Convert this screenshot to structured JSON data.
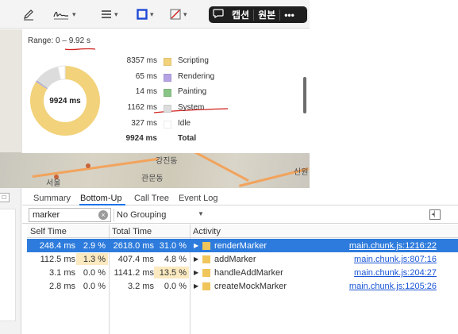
{
  "toolbar": {
    "pill": {
      "caption": "캡션",
      "original": "원본",
      "more": "•••"
    }
  },
  "map": {
    "labels": [
      "서울",
      "관문동",
      "신원",
      "강진동"
    ]
  },
  "summary": {
    "range_label": "Range: 0 – 9.92 s",
    "center_label": "9924 ms",
    "legend": [
      {
        "ms": "8357 ms",
        "name": "Scripting",
        "color": "#f2d27a"
      },
      {
        "ms": "65 ms",
        "name": "Rendering",
        "color": "#b5a3e4"
      },
      {
        "ms": "14 ms",
        "name": "Painting",
        "color": "#89c487"
      },
      {
        "ms": "1162 ms",
        "name": "System",
        "color": "#dcdcdc"
      },
      {
        "ms": "327 ms",
        "name": "Idle",
        "color": "#ffffff"
      }
    ],
    "total": {
      "ms": "9924 ms",
      "name": "Total"
    }
  },
  "devtools": {
    "tabs": [
      "Summary",
      "Bottom-Up",
      "Call Tree",
      "Event Log"
    ],
    "active_tab": "Bottom-Up",
    "filter": {
      "value": "marker",
      "placeholder": "Filter"
    },
    "grouping": "No Grouping",
    "columns": {
      "self": "Self Time",
      "total": "Total Time",
      "activity": "Activity"
    },
    "rows": [
      {
        "self_ms": "248.4 ms",
        "self_pct": "2.9 %",
        "total_ms": "2618.0 ms",
        "total_pct": "31.0 %",
        "activity": "renderMarker",
        "source": "main.chunk.js:1216:22",
        "selected": true
      },
      {
        "self_ms": "112.5 ms",
        "self_pct": "1.3 %",
        "total_ms": "407.4 ms",
        "total_pct": "4.8 %",
        "activity": "addMarker",
        "source": "main.chunk.js:807:16",
        "selected": false
      },
      {
        "self_ms": "3.1 ms",
        "self_pct": "0.0 %",
        "total_ms": "1141.2 ms",
        "total_pct": "13.5 %",
        "activity": "handleAddMarker",
        "source": "main.chunk.js:204:27",
        "selected": false
      },
      {
        "self_ms": "2.8 ms",
        "self_pct": "0.0 %",
        "total_ms": "3.2 ms",
        "total_pct": "0.0 %",
        "activity": "createMockMarker",
        "source": "main.chunk.js:1205:26",
        "selected": false
      }
    ]
  },
  "colors": {
    "selection": "#2d7bdc",
    "link": "#1a55d6",
    "annotation": "#d0201c"
  }
}
